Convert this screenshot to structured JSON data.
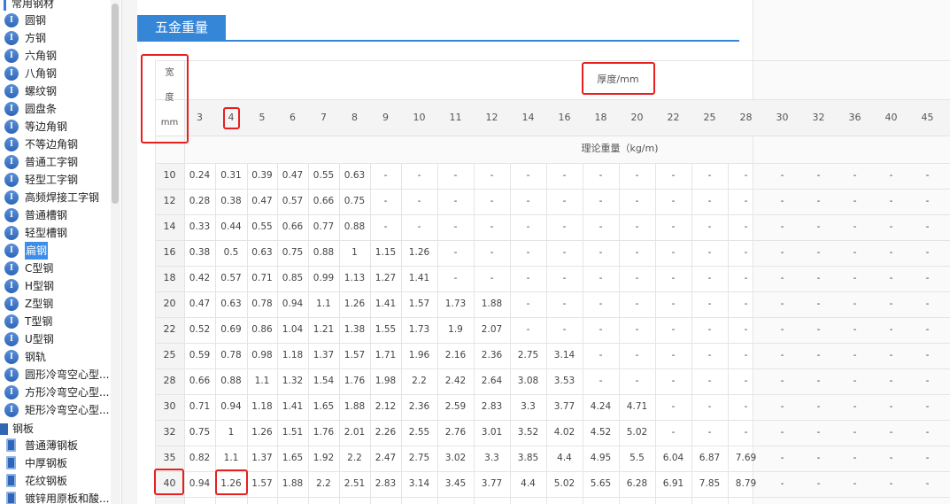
{
  "sidebar": {
    "top_group": "常用钢材",
    "items": [
      {
        "label": "圆钢"
      },
      {
        "label": "方钢"
      },
      {
        "label": "六角钢"
      },
      {
        "label": "八角钢"
      },
      {
        "label": "螺纹钢"
      },
      {
        "label": "圆盘条"
      },
      {
        "label": "等边角钢"
      },
      {
        "label": "不等边角钢"
      },
      {
        "label": "普通工字钢"
      },
      {
        "label": "轻型工字钢"
      },
      {
        "label": "高频焊接工字钢"
      },
      {
        "label": "普通槽钢"
      },
      {
        "label": "轻型槽钢"
      },
      {
        "label": "扁钢",
        "selected": true
      },
      {
        "label": "C型钢"
      },
      {
        "label": "H型钢"
      },
      {
        "label": "Z型钢"
      },
      {
        "label": "T型钢"
      },
      {
        "label": "U型钢"
      },
      {
        "label": "钢轨"
      },
      {
        "label": "圆形冷弯空心型..."
      },
      {
        "label": "方形冷弯空心型..."
      },
      {
        "label": "矩形冷弯空心型..."
      }
    ],
    "group2": "钢板",
    "plate_items": [
      {
        "label": "普通薄钢板"
      },
      {
        "label": "中厚钢板"
      },
      {
        "label": "花纹钢板"
      },
      {
        "label": "镀锌用原板和酸..."
      }
    ]
  },
  "tab": {
    "label": "五金重量"
  },
  "table": {
    "width_header": [
      "宽",
      "度",
      "mm"
    ],
    "thickness_title": "厚度/mm",
    "unit_label": "理论重量（kg/m)",
    "thicknesses": [
      "3",
      "4",
      "5",
      "6",
      "7",
      "8",
      "9",
      "10",
      "11",
      "12",
      "14",
      "16",
      "18",
      "20",
      "22",
      "25",
      "28",
      "30",
      "32",
      "36",
      "40",
      "45"
    ],
    "rows": [
      {
        "w": "10",
        "v": [
          "0.24",
          "0.31",
          "0.39",
          "0.47",
          "0.55",
          "0.63",
          "-",
          "-",
          "-",
          "-",
          "-",
          "-",
          "-",
          "-",
          "-",
          "-",
          "-",
          "-",
          "-",
          "-",
          "-",
          "-"
        ]
      },
      {
        "w": "12",
        "v": [
          "0.28",
          "0.38",
          "0.47",
          "0.57",
          "0.66",
          "0.75",
          "-",
          "-",
          "-",
          "-",
          "-",
          "-",
          "-",
          "-",
          "-",
          "-",
          "-",
          "-",
          "-",
          "-",
          "-",
          "-"
        ]
      },
      {
        "w": "14",
        "v": [
          "0.33",
          "0.44",
          "0.55",
          "0.66",
          "0.77",
          "0.88",
          "-",
          "-",
          "-",
          "-",
          "-",
          "-",
          "-",
          "-",
          "-",
          "-",
          "-",
          "-",
          "-",
          "-",
          "-",
          "-"
        ]
      },
      {
        "w": "16",
        "v": [
          "0.38",
          "0.5",
          "0.63",
          "0.75",
          "0.88",
          "1",
          "1.15",
          "1.26",
          "-",
          "-",
          "-",
          "-",
          "-",
          "-",
          "-",
          "-",
          "-",
          "-",
          "-",
          "-",
          "-",
          "-"
        ]
      },
      {
        "w": "18",
        "v": [
          "0.42",
          "0.57",
          "0.71",
          "0.85",
          "0.99",
          "1.13",
          "1.27",
          "1.41",
          "-",
          "-",
          "-",
          "-",
          "-",
          "-",
          "-",
          "-",
          "-",
          "-",
          "-",
          "-",
          "-",
          "-"
        ]
      },
      {
        "w": "20",
        "v": [
          "0.47",
          "0.63",
          "0.78",
          "0.94",
          "1.1",
          "1.26",
          "1.41",
          "1.57",
          "1.73",
          "1.88",
          "-",
          "-",
          "-",
          "-",
          "-",
          "-",
          "-",
          "-",
          "-",
          "-",
          "-",
          "-"
        ]
      },
      {
        "w": "22",
        "v": [
          "0.52",
          "0.69",
          "0.86",
          "1.04",
          "1.21",
          "1.38",
          "1.55",
          "1.73",
          "1.9",
          "2.07",
          "-",
          "-",
          "-",
          "-",
          "-",
          "-",
          "-",
          "-",
          "-",
          "-",
          "-",
          "-"
        ]
      },
      {
        "w": "25",
        "v": [
          "0.59",
          "0.78",
          "0.98",
          "1.18",
          "1.37",
          "1.57",
          "1.71",
          "1.96",
          "2.16",
          "2.36",
          "2.75",
          "3.14",
          "-",
          "-",
          "-",
          "-",
          "-",
          "-",
          "-",
          "-",
          "-",
          "-"
        ]
      },
      {
        "w": "28",
        "v": [
          "0.66",
          "0.88",
          "1.1",
          "1.32",
          "1.54",
          "1.76",
          "1.98",
          "2.2",
          "2.42",
          "2.64",
          "3.08",
          "3.53",
          "-",
          "-",
          "-",
          "-",
          "-",
          "-",
          "-",
          "-",
          "-",
          "-"
        ]
      },
      {
        "w": "30",
        "v": [
          "0.71",
          "0.94",
          "1.18",
          "1.41",
          "1.65",
          "1.88",
          "2.12",
          "2.36",
          "2.59",
          "2.83",
          "3.3",
          "3.77",
          "4.24",
          "4.71",
          "-",
          "-",
          "-",
          "-",
          "-",
          "-",
          "-",
          "-"
        ]
      },
      {
        "w": "32",
        "v": [
          "0.75",
          "1",
          "1.26",
          "1.51",
          "1.76",
          "2.01",
          "2.26",
          "2.55",
          "2.76",
          "3.01",
          "3.52",
          "4.02",
          "4.52",
          "5.02",
          "-",
          "-",
          "-",
          "-",
          "-",
          "-",
          "-",
          "-"
        ]
      },
      {
        "w": "35",
        "v": [
          "0.82",
          "1.1",
          "1.37",
          "1.65",
          "1.92",
          "2.2",
          "2.47",
          "2.75",
          "3.02",
          "3.3",
          "3.85",
          "4.4",
          "4.95",
          "5.5",
          "6.04",
          "6.87",
          "7.69",
          "-",
          "-",
          "-",
          "-",
          "-"
        ]
      },
      {
        "w": "40",
        "v": [
          "0.94",
          "1.26",
          "1.57",
          "1.88",
          "2.2",
          "2.51",
          "2.83",
          "3.14",
          "3.45",
          "3.77",
          "4.4",
          "5.02",
          "5.65",
          "6.28",
          "6.91",
          "7.85",
          "8.79",
          "-",
          "-",
          "-",
          "-",
          "-"
        ]
      }
    ]
  }
}
